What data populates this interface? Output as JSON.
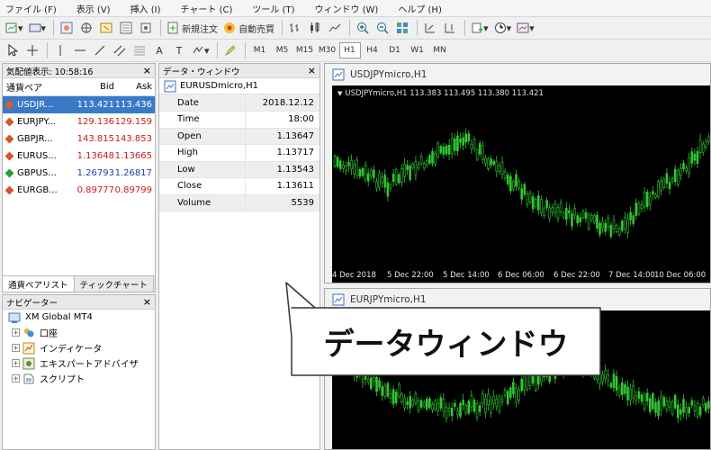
{
  "menu": [
    "ファイル (F)",
    "表示 (V)",
    "挿入 (I)",
    "チャート (C)",
    "ツール (T)",
    "ウィンドウ (W)",
    "ヘルプ (H)"
  ],
  "toolbar": {
    "new_order": "新規注文",
    "auto_trading": "自動売買",
    "text_tool": "A",
    "text_label_tool": "T",
    "timeframes": [
      "M1",
      "M5",
      "M15",
      "M30",
      "H1",
      "H4",
      "D1",
      "W1",
      "MN"
    ],
    "active_timeframe": "H1"
  },
  "market_watch": {
    "title": "気配値表示: 10:58:16",
    "col_symbol": "通貨ペア",
    "col_bid": "Bid",
    "col_ask": "Ask",
    "rows": [
      {
        "symbol": "USDJR...",
        "bid": "113.421",
        "ask": "113.436",
        "selected": true,
        "color": "#e06020"
      },
      {
        "symbol": "EURJPY...",
        "bid": "129.136",
        "ask": "129.159",
        "selected": false,
        "color": "#d9532c"
      },
      {
        "symbol": "GBPJR...",
        "bid": "143.815",
        "ask": "143.853",
        "selected": false,
        "color": "#d9532c"
      },
      {
        "symbol": "EURUS...",
        "bid": "1.13648",
        "ask": "1.13665",
        "selected": false,
        "color": "#d9532c"
      },
      {
        "symbol": "GBPUS...",
        "bid": "1.26793",
        "ask": "1.26817",
        "selected": false,
        "color": "#2f9a3a"
      },
      {
        "symbol": "EURGB...",
        "bid": "0.89777",
        "ask": "0.89799",
        "selected": false,
        "color": "#d9532c"
      }
    ],
    "tabs": [
      "通貨ペアリスト",
      "ティックチャート"
    ],
    "bid_color": "#cc1a1a",
    "blue_color": "#1a3fb0"
  },
  "navigator": {
    "title": "ナビゲーター",
    "root": "XM Global MT4",
    "items": [
      "口座",
      "インディケータ",
      "エキスパートアドバイザ",
      "スクリプト"
    ]
  },
  "data_window": {
    "title": "データ・ウィンドウ",
    "symbol": "EURUSDmicro,H1",
    "rows": [
      {
        "key": "Date",
        "value": "2018.12.12"
      },
      {
        "key": "Time",
        "value": "18:00"
      },
      {
        "key": "Open",
        "value": "1.13647"
      },
      {
        "key": "High",
        "value": "1.13717"
      },
      {
        "key": "Low",
        "value": "1.13543"
      },
      {
        "key": "Close",
        "value": "1.13611"
      },
      {
        "key": "Volume",
        "value": "5539"
      }
    ]
  },
  "chart1": {
    "title": "USDJPYmicro,H1",
    "subtitle": "USDJPYmicro,H1  113.383 113.495 113.380 113.421",
    "time_labels": [
      "4 Dec 2018",
      "5 Dec 22:00",
      "5 Dec 14:00",
      "6 Dec 06:00",
      "6 Dec 22:00",
      "7 Dec 14:00",
      "10 Dec 06:00"
    ],
    "candle_color": "#2ec82e"
  },
  "chart2": {
    "title": "EURJPYmicro,H1"
  },
  "callout": {
    "text": "データウィンドウ"
  }
}
